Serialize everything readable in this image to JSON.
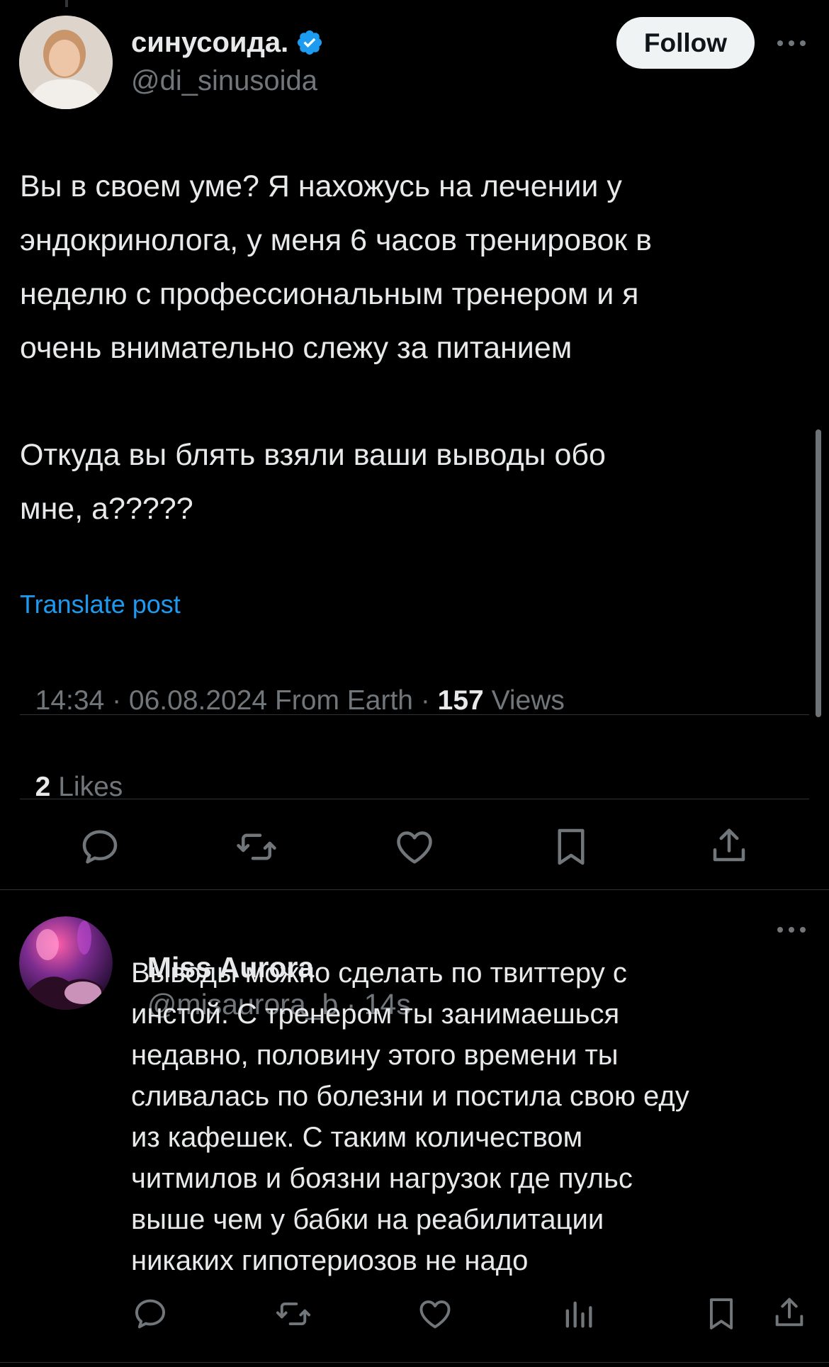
{
  "post": {
    "author_name": "синусоида.",
    "author_handle": "@di_sinusoida",
    "follow_label": "Follow",
    "text_lines": [
      "Вы в своем уме? Я нахожусь на лечении у",
      "эндокринолога, у меня 6 часов тренировок в",
      "неделю с профессиональным тренером и я",
      "очень внимательно слежу за питанием"
    ],
    "text_lines_2": [
      "Откуда вы блять взяли ваши выводы обо",
      "мне, а?????"
    ],
    "translate_label": "Translate post",
    "timestamp": "14:34 · 06.08.2024 From Earth · ",
    "views_count": "157",
    "views_label": " Views",
    "likes_count": "2",
    "likes_label": " Likes"
  },
  "reply": {
    "author_name": "Miss Aurora",
    "author_handle": "@misaurora_b",
    "time": " · 14s",
    "text_lines": [
      "Выводы можно сделать по твиттеру с",
      "инстой. С тренером ты занимаешься",
      "недавно, половину этого времени ты",
      "сливалась по болезни и постила свою еду",
      "из кафешек. С таким количеством",
      "читмилов и боязни нагрузок где пульс",
      "выше чем у бабки на реабилитации",
      "никаких гипотериозов не надо"
    ]
  },
  "colors": {
    "background": "#000000",
    "text": "#e7e9ea",
    "muted": "#71767b",
    "link": "#1d9bf0",
    "verified": "#1d9bf0",
    "divider": "#2f3336"
  },
  "icons": {
    "verified": "verified-badge-icon",
    "more": "more-horizontal-icon",
    "reply": "reply-icon",
    "repost": "repost-icon",
    "like": "like-icon",
    "bookmark": "bookmark-icon",
    "share": "share-icon",
    "views": "views-icon"
  }
}
